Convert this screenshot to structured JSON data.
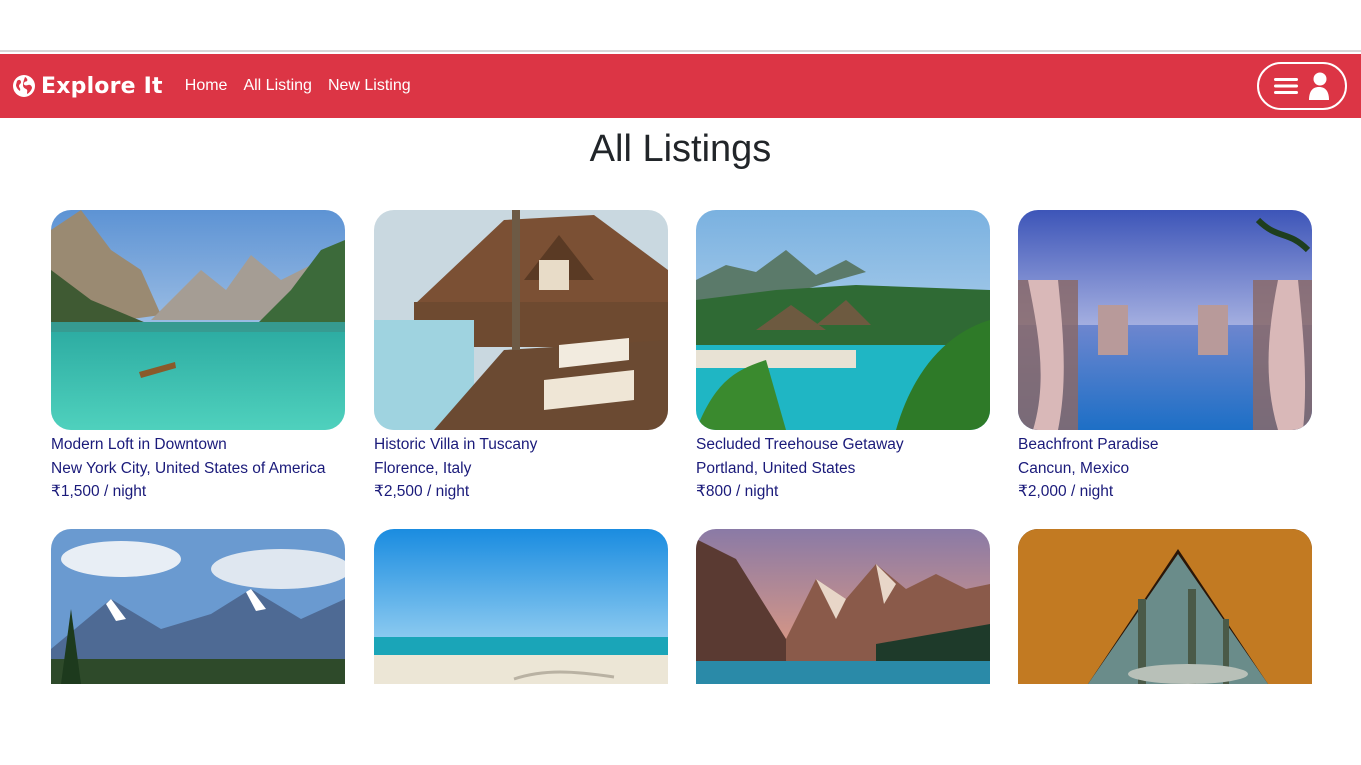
{
  "navbar": {
    "brand": "Explore It",
    "brand_icon": "globe-icon",
    "links": [
      "Home",
      "All Listing",
      "New Listing"
    ],
    "menu_icon": "hamburger-icon",
    "user_icon": "user-icon",
    "accent_color": "#dc3545"
  },
  "page": {
    "title": "All Listings"
  },
  "listings": [
    {
      "title": "Modern Loft in Downtown",
      "location": "New York City, United States of America",
      "price": "₹1,500 / night",
      "image": "mountain-lake"
    },
    {
      "title": "Historic Villa in Tuscany",
      "location": "Florence, Italy",
      "price": "₹2,500 / night",
      "image": "villa-pool"
    },
    {
      "title": "Secluded Treehouse Getaway",
      "location": "Portland, United States",
      "price": "₹800 / night",
      "image": "tropical-pool"
    },
    {
      "title": "Beachfront Paradise",
      "location": "Cancun, Mexico",
      "price": "₹2,000 / night",
      "image": "infinity-pool-sunset"
    },
    {
      "image": "snowy-mountains"
    },
    {
      "image": "tropical-beach"
    },
    {
      "image": "mountain-lake-dawn"
    },
    {
      "image": "tent-forest"
    }
  ]
}
